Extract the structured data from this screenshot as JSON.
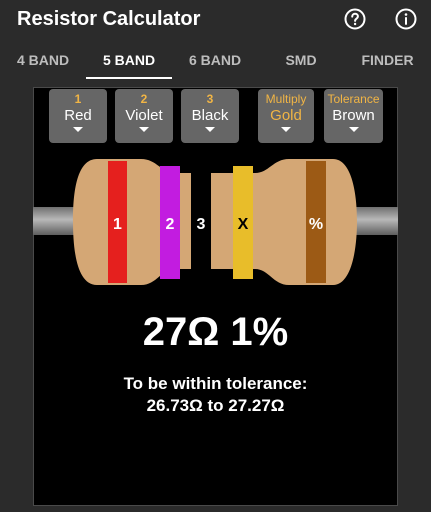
{
  "app": {
    "title": "Resistor Calculator"
  },
  "tabs": [
    {
      "label": "4 BAND"
    },
    {
      "label": "5 BAND"
    },
    {
      "label": "6 BAND"
    },
    {
      "label": "SMD"
    },
    {
      "label": "FINDER"
    }
  ],
  "selectors": [
    {
      "header": "1",
      "value": "Red"
    },
    {
      "header": "2",
      "value": "Violet"
    },
    {
      "header": "3",
      "value": "Black"
    },
    {
      "header": "Multiply",
      "value": "Gold"
    },
    {
      "header": "Tolerance",
      "value": "Brown"
    }
  ],
  "bands": [
    {
      "label": "1",
      "color": "#e5201e"
    },
    {
      "label": "2",
      "color": "#c21ce0"
    },
    {
      "label": "3",
      "color": "#000000"
    },
    {
      "label": "X",
      "color": "#e8bd2a"
    },
    {
      "label": "%",
      "color": "#9c5a15"
    }
  ],
  "result": {
    "value": "27Ω 1%",
    "tolerance_title": "To be within tolerance:",
    "tolerance_range": "26.73Ω to 27.27Ω"
  },
  "colors": {
    "body": "#d4a775",
    "lead": "#8c8c8c",
    "accent": "#f1b545",
    "selector_bg": "#666666"
  },
  "icons": {
    "help": "help-circle-icon",
    "info": "info-circle-icon"
  }
}
